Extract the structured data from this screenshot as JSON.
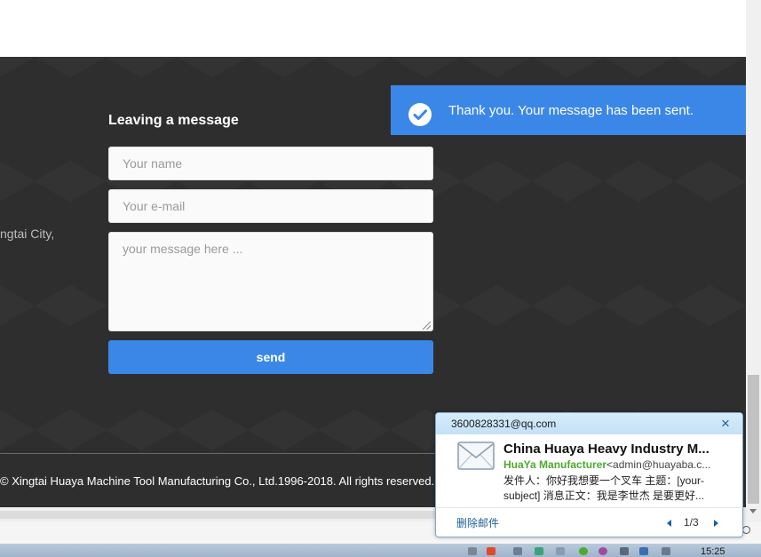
{
  "form": {
    "title": "Leaving a message",
    "name_placeholder": "Your name",
    "email_placeholder": "Your e-mail",
    "message_placeholder": "your message here ...",
    "send_label": "send"
  },
  "footer": {
    "address_fragment": "ngtai City,",
    "copyright": "© Xingtai Huaya Machine Tool Manufacturing Co., Ltd.1996-2018. All rights reserved."
  },
  "toast": {
    "message": "Thank you. Your message has been sent.",
    "icon": "check-circle-icon",
    "color": "#3b87e8"
  },
  "mail_popup": {
    "account": "3600828331@qq.com",
    "subject": "China Huaya Heavy Industry M...",
    "sender_name": "HuaYa Manufacturer",
    "sender_email": "<admin@huayaba.c...",
    "preview": "发件人：你好我想要一个叉车 主题：[your-subject] 消息正文：我是李世杰 是要更好...",
    "delete_label": "删除邮件",
    "pager": "1/3",
    "sender_color": "#4caa2c"
  },
  "taskbar": {
    "clock": "15:25"
  }
}
